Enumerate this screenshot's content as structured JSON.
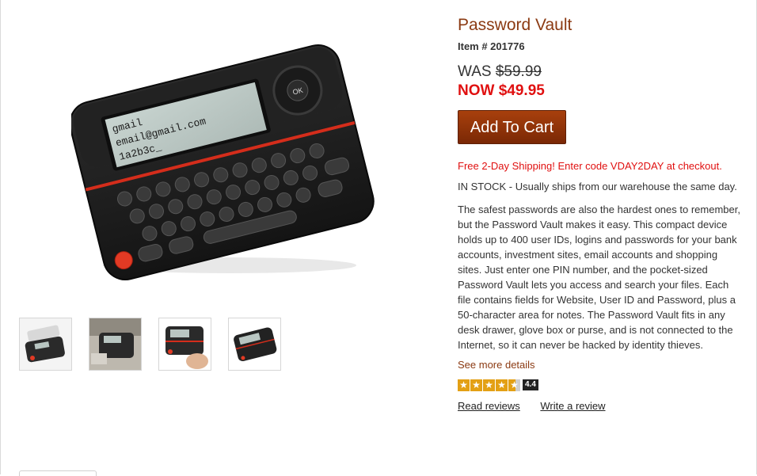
{
  "product": {
    "title": "Password Vault",
    "item_number": "Item # 201776",
    "was_label": "WAS",
    "was_price": "$59.99",
    "now_price": "NOW $49.95",
    "add_to_cart": "Add To Cart",
    "promo": "Free 2-Day Shipping! Enter code VDAY2DAY at checkout.",
    "stock": "IN STOCK - Usually ships from our warehouse the same day.",
    "description": "The safest passwords are also the hardest ones to remember, but the Password Vault makes it easy. This compact device holds up to 400 user IDs, logins and passwords for your bank accounts, investment sites, email accounts and shopping sites. Just enter one PIN number, and the pocket-sized Password Vault lets you access and search your files. Each file contains fields for Website, User ID and Password, plus a 50-character area for notes. The Password Vault fits in any desk drawer, glove box or purse, and is not connected to the Internet, so it can never be hacked by identity thieves.",
    "see_more": "See more details",
    "rating": 4.4,
    "rating_label": "4.4",
    "read_reviews": "Read reviews",
    "write_review": "Write a review"
  },
  "device_screen": {
    "line1": "gmail",
    "line2": "email@gmail.com",
    "line3": "1a2b3c_"
  },
  "colors": {
    "title": "#8b3a12",
    "price_now": "#e01010",
    "button": "#8f3408",
    "star": "#e3a014"
  }
}
